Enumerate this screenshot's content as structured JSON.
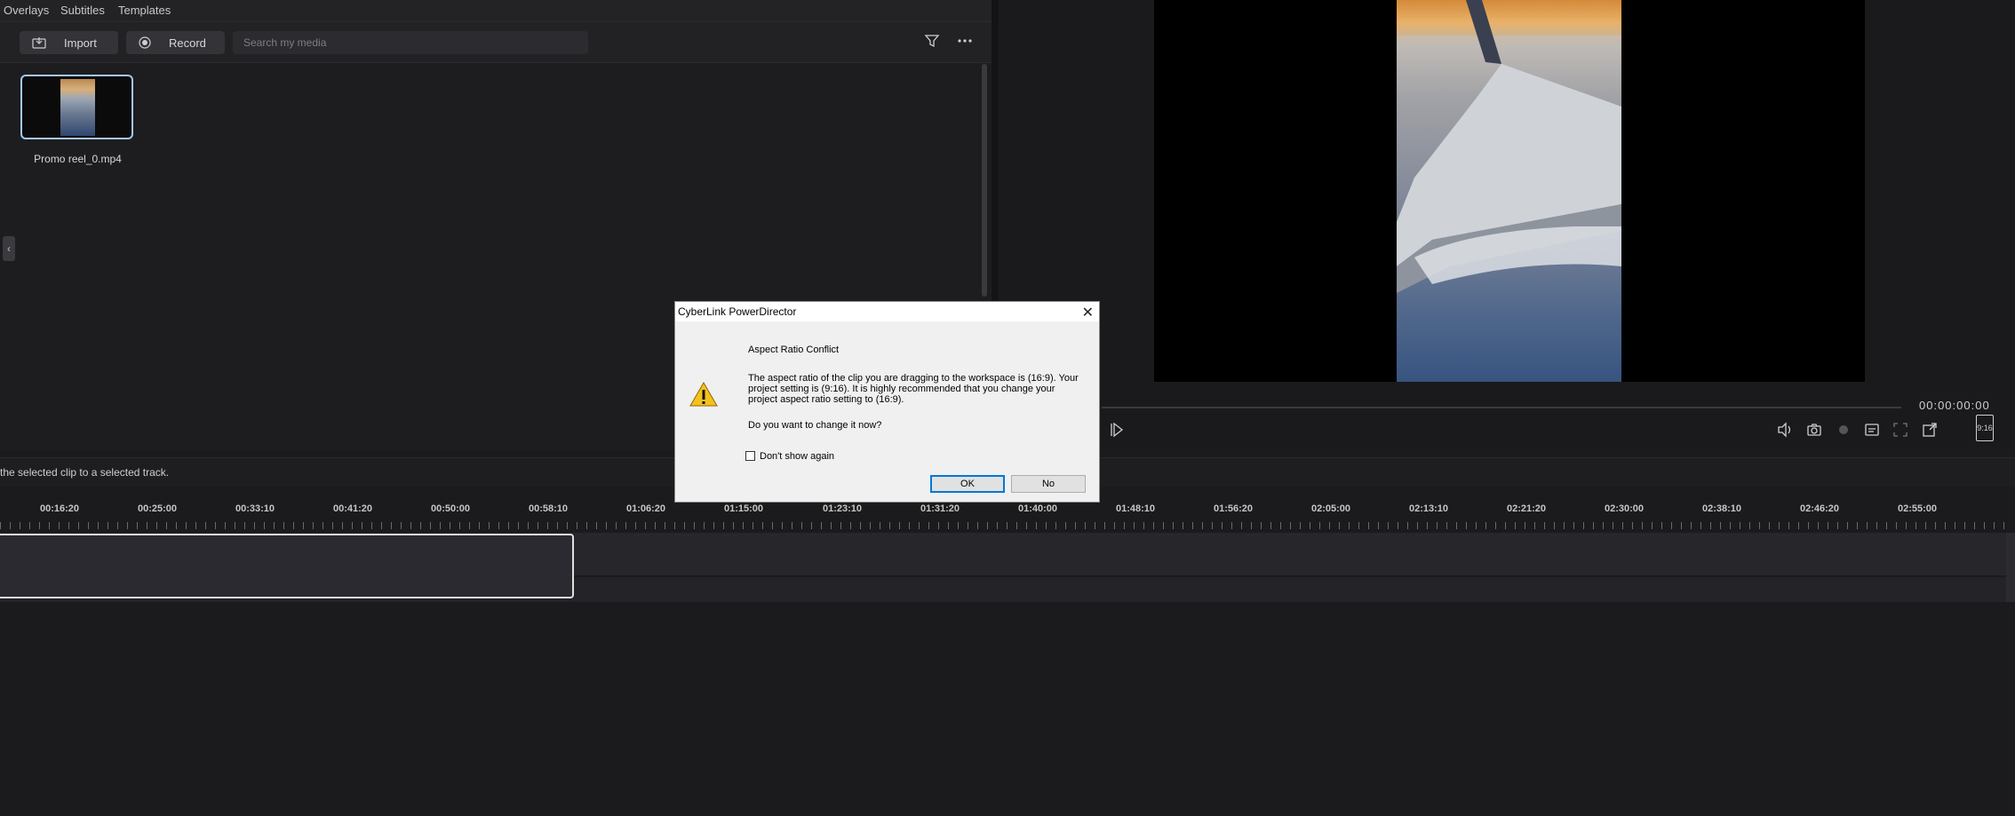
{
  "top_tabs": [
    "Overlays",
    "Subtitles",
    "Templates"
  ],
  "toolbar": {
    "import_label": "Import",
    "record_label": "Record",
    "search_placeholder": "Search my media"
  },
  "media": {
    "items": [
      {
        "name": "Promo reel_0.mp4"
      }
    ]
  },
  "preview": {
    "timecode": "00:00:00:00",
    "aspect_label": "9:16"
  },
  "hint": "the selected clip to a selected track.",
  "timeline": {
    "ticks": [
      "00:16:20",
      "00:25:00",
      "00:33:10",
      "00:41:20",
      "00:50:00",
      "00:58:10",
      "01:06:20",
      "01:15:00",
      "01:23:10",
      "01:31:20",
      "01:40:00",
      "01:48:10",
      "01:56:20",
      "02:05:00",
      "02:13:10",
      "02:21:20",
      "02:30:00",
      "02:38:10",
      "02:46:20",
      "02:55:00"
    ]
  },
  "dialog": {
    "title": "CyberLink PowerDirector",
    "heading": "Aspect Ratio Conflict",
    "body": "The aspect ratio of the clip you are dragging to the workspace is (16:9). Your project setting is (9:16). It is highly recommended that you change your project aspect ratio setting to (16:9).",
    "question": "Do you want to change it now?",
    "checkbox_label": "Don't show again",
    "ok_label": "OK",
    "no_label": "No"
  },
  "icons": {
    "import": "import-icon",
    "record": "record-icon",
    "filter": "filter-icon",
    "more": "more-icon",
    "warning": "warning-icon"
  }
}
